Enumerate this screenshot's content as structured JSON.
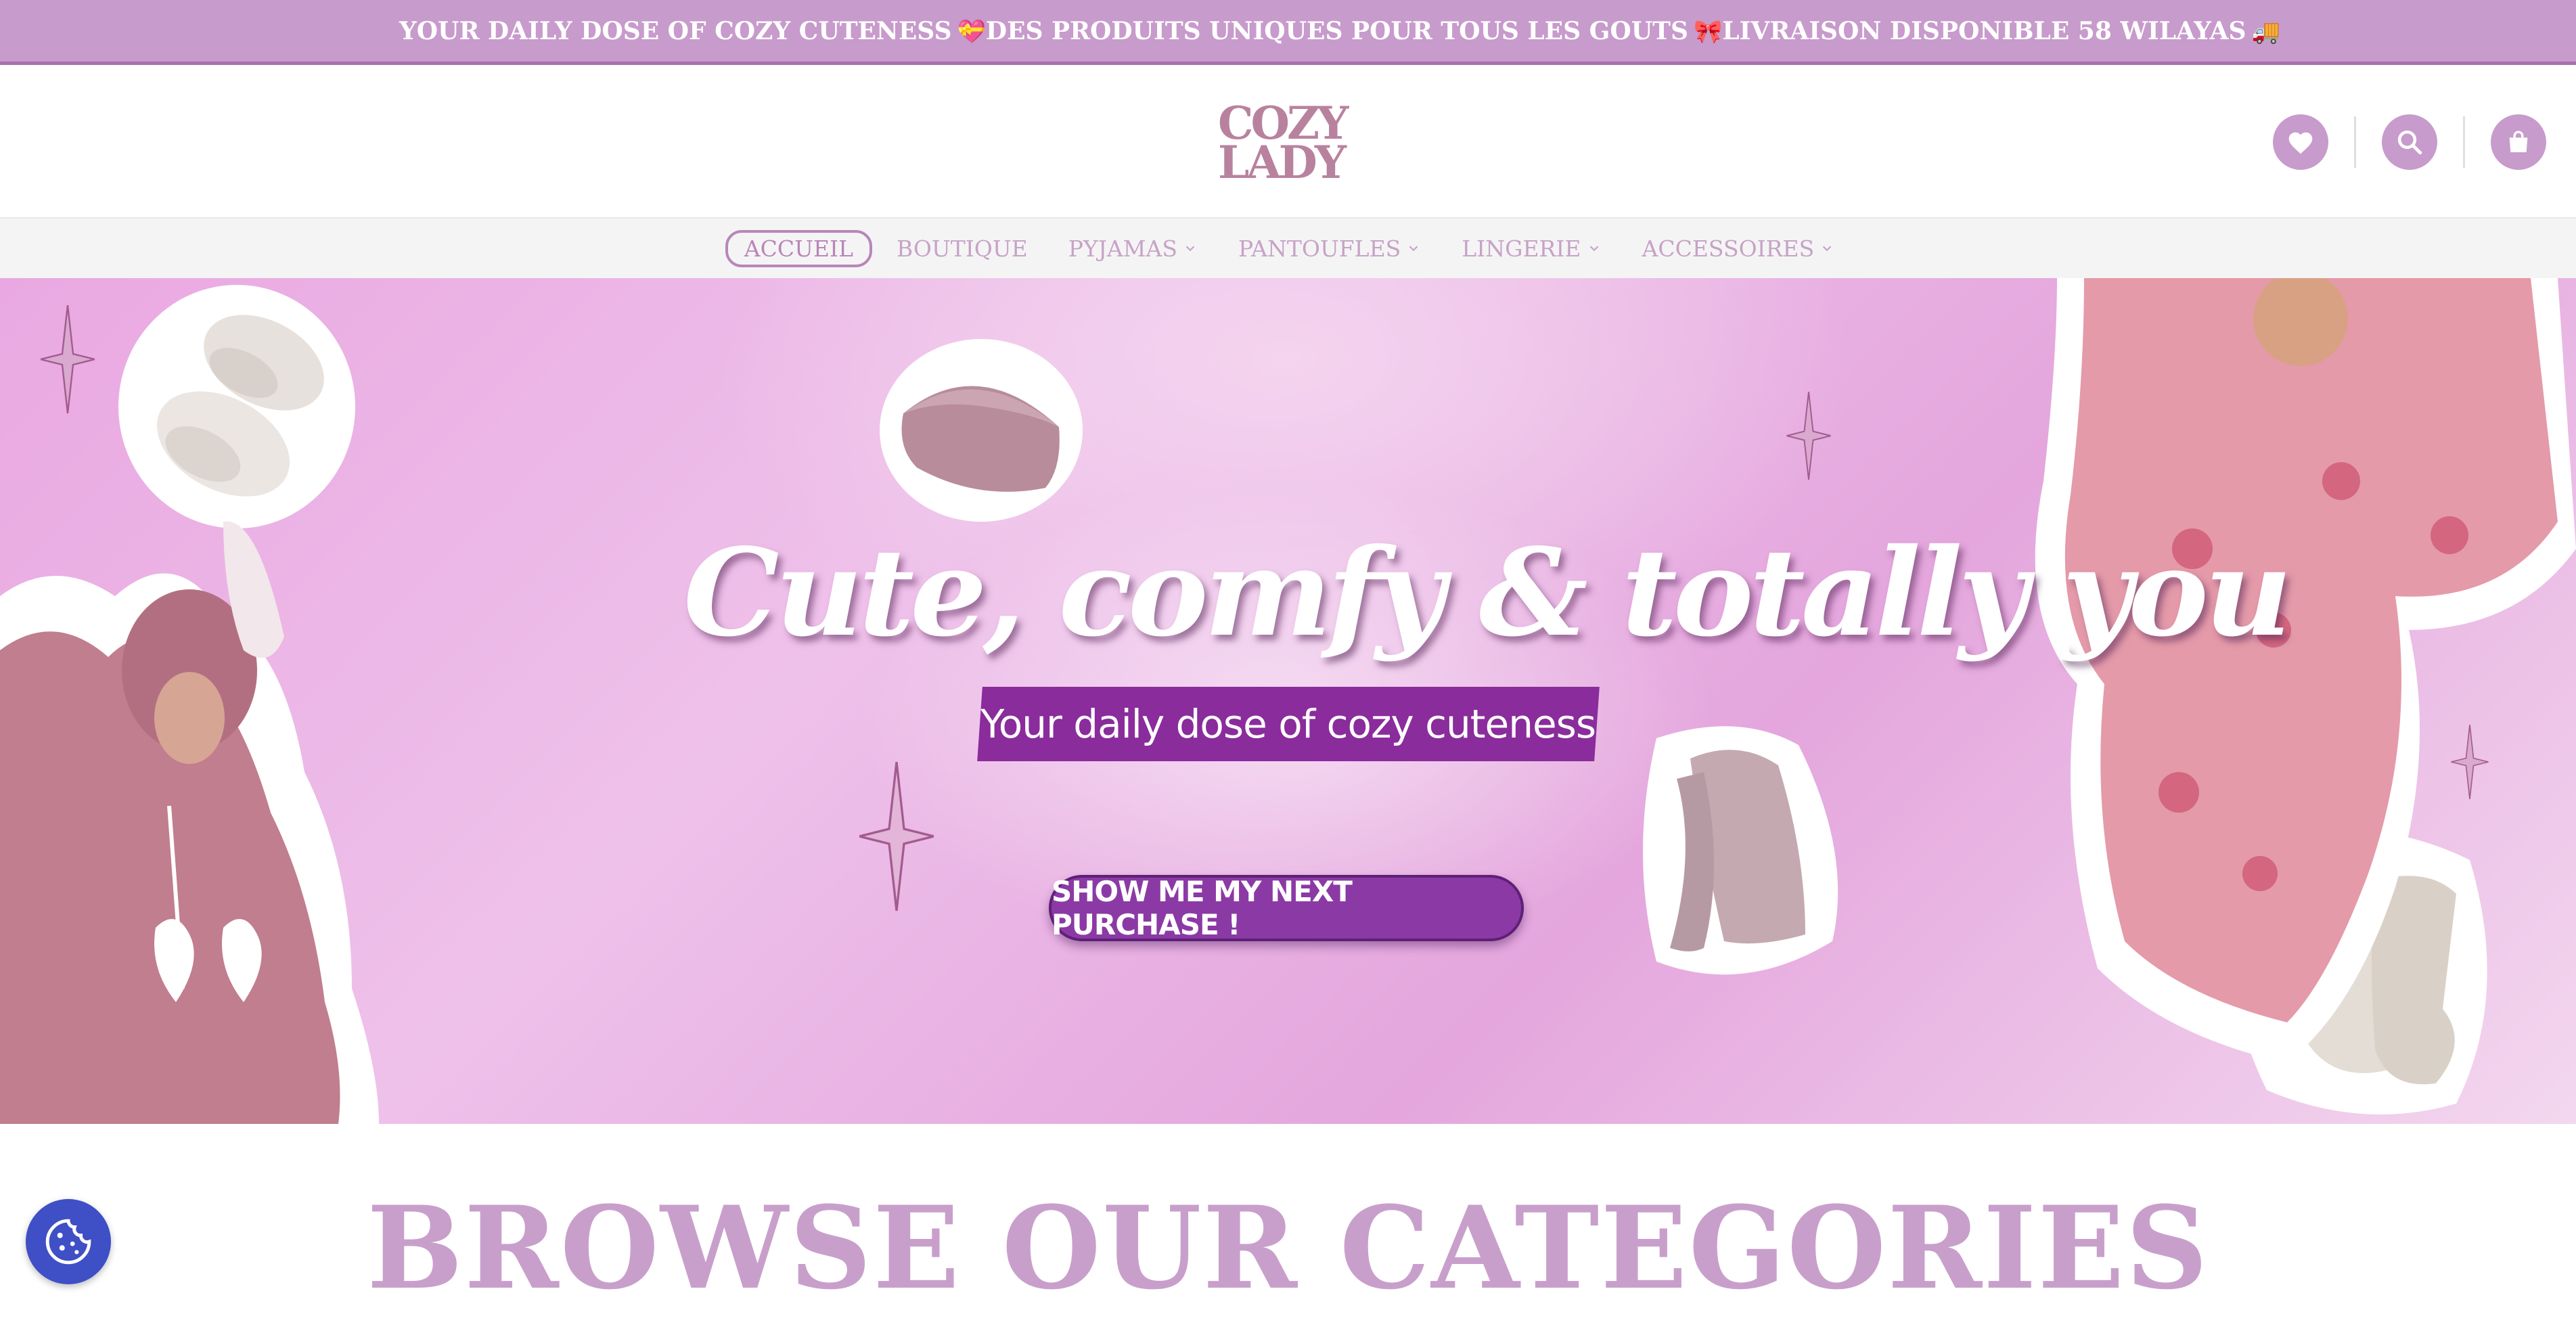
{
  "announcement": {
    "items": [
      {
        "text": "YOUR DAILY DOSE OF COZY CUTENESS",
        "emoji": "💝"
      },
      {
        "text": "DES PRODUITS UNIQUES POUR TOUS LES GOUTS",
        "emoji": "🎀"
      },
      {
        "text": "LIVRAISON DISPONIBLE 58 WILAYAS",
        "emoji": "🚚"
      }
    ]
  },
  "header": {
    "logo_line1": "COZY",
    "logo_line2": "LADY",
    "icons": [
      "heart-icon",
      "search-icon",
      "shopping-bag-icon"
    ]
  },
  "nav": {
    "items": [
      {
        "label": "ACCUEIL",
        "active": true,
        "dropdown": false
      },
      {
        "label": "BOUTIQUE",
        "active": false,
        "dropdown": false
      },
      {
        "label": "PYJAMAS",
        "active": false,
        "dropdown": true
      },
      {
        "label": "PANTOUFLES",
        "active": false,
        "dropdown": true
      },
      {
        "label": "LINGERIE",
        "active": false,
        "dropdown": true
      },
      {
        "label": "ACCESSOIRES",
        "active": false,
        "dropdown": true
      }
    ]
  },
  "hero": {
    "title": "Cute, comfy & totally you",
    "subtitle": "Your daily dose of cozy cuteness",
    "cta_label": "SHOW ME MY NEXT PURCHASE !"
  },
  "browse": {
    "title": "BROWSE OUR CATEGORIES"
  },
  "colors": {
    "brand": "#c79bcb",
    "accent_purple": "#8a2c9c",
    "cookie_button": "#3f4fc6"
  }
}
